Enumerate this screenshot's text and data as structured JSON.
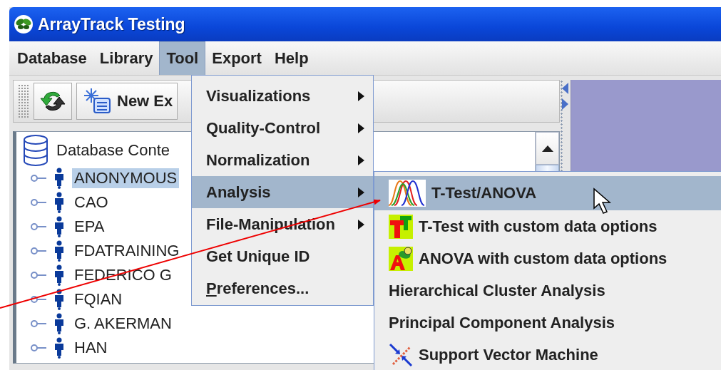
{
  "window": {
    "title": "ArrayTrack Testing"
  },
  "menubar": [
    {
      "label": "Database",
      "selected": false
    },
    {
      "label": "Library",
      "selected": false
    },
    {
      "label": "Tool",
      "selected": true
    },
    {
      "label": "Export",
      "selected": false
    },
    {
      "label": "Help",
      "selected": false
    }
  ],
  "toolbar": {
    "new_button": "New Ex"
  },
  "tree": {
    "root": "Database Conte",
    "items": [
      {
        "label": "ANONYMOUS",
        "selected": true
      },
      {
        "label": "CAO",
        "selected": false
      },
      {
        "label": "EPA",
        "selected": false
      },
      {
        "label": "FDATRAINING",
        "selected": false
      },
      {
        "label": "FEDERICO G",
        "selected": false
      },
      {
        "label": "FQIAN",
        "selected": false
      },
      {
        "label": "G. AKERMAN",
        "selected": false
      },
      {
        "label": "HAN",
        "selected": false
      }
    ]
  },
  "tool_menu": [
    {
      "label": "Visualizations",
      "submenu": true,
      "selected": false,
      "mnemonic_underlined": false
    },
    {
      "label": "Quality-Control",
      "submenu": true,
      "selected": false,
      "mnemonic_underlined": false
    },
    {
      "label": "Normalization",
      "submenu": true,
      "selected": false,
      "mnemonic_underlined": false
    },
    {
      "label": "Analysis",
      "submenu": true,
      "selected": true,
      "mnemonic_underlined": false
    },
    {
      "label": "File-Manipulation",
      "submenu": true,
      "selected": false,
      "mnemonic_underlined": false
    },
    {
      "label": "Get Unique ID",
      "submenu": false,
      "selected": false,
      "mnemonic_underlined": false
    },
    {
      "label": "Preferences...",
      "submenu": false,
      "selected": false,
      "mnemonic_underlined": true
    }
  ],
  "analysis_menu": [
    {
      "label": "T-Test/ANOVA",
      "kind": "curves",
      "selected": true
    },
    {
      "label": "T-Test with custom data options",
      "kind": "ttest",
      "selected": false
    },
    {
      "label": "ANOVA with custom data options",
      "kind": "anova",
      "selected": false
    },
    {
      "label": "Hierarchical Cluster Analysis",
      "kind": "plain",
      "selected": false
    },
    {
      "label": "Principal Component Analysis",
      "kind": "plain",
      "selected": false
    },
    {
      "label": "Support Vector Machine",
      "kind": "svm",
      "selected": false
    }
  ]
}
